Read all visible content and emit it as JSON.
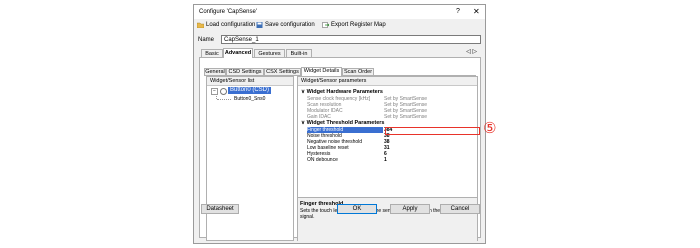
{
  "window": {
    "title": "Configure 'CapSense'",
    "help": "?",
    "close": "✕"
  },
  "toolbar": {
    "load": "Load configuration",
    "save": "Save configuration",
    "export": "Export Register Map"
  },
  "name": {
    "label": "Name",
    "value": "CapSense_1"
  },
  "tabs": [
    "Basic",
    "Advanced",
    "Gestures",
    "Built-in"
  ],
  "tab_arrows": "◁ ▷",
  "subtabs": [
    "General",
    "CSD Settings",
    "CSX Settings",
    "Widget Details",
    "Scan Order"
  ],
  "left_pane": {
    "header": "Widget/Sensor list",
    "root": "Button0 (CSD)",
    "child": "Button0_Sns0"
  },
  "right_pane": {
    "header": "Widget/Sensor parameters",
    "hw_section": "Widget Hardware Parameters",
    "hw_rows": [
      {
        "k": "Sense clock frequency [kHz]",
        "v": "Set by SmartSense"
      },
      {
        "k": "Scan resolution",
        "v": "Set by SmartSense"
      },
      {
        "k": "Modulator IDAC",
        "v": "Set by SmartSense"
      },
      {
        "k": "Gain IDAC",
        "v": "Set by SmartSense"
      }
    ],
    "th_section": "Widget Threshold Parameters",
    "th_rows": [
      {
        "k": "Finger threshold",
        "v": "384"
      },
      {
        "k": "Noise threshold",
        "v": "38"
      },
      {
        "k": "Negative noise threshold",
        "v": "38"
      },
      {
        "k": "Low baseline reset",
        "v": "31"
      },
      {
        "k": "Hysteresis",
        "v": "6"
      },
      {
        "k": "ON debounce",
        "v": "1"
      }
    ],
    "desc_title": "Finger threshold",
    "desc_text": "Sets the touch level to determine the sensor state based on the signal."
  },
  "buttons": {
    "datasheet": "Datasheet",
    "ok": "OK",
    "apply": "Apply",
    "cancel": "Cancel"
  },
  "callout": {
    "label": "⑤",
    "color": "#e8332a"
  }
}
